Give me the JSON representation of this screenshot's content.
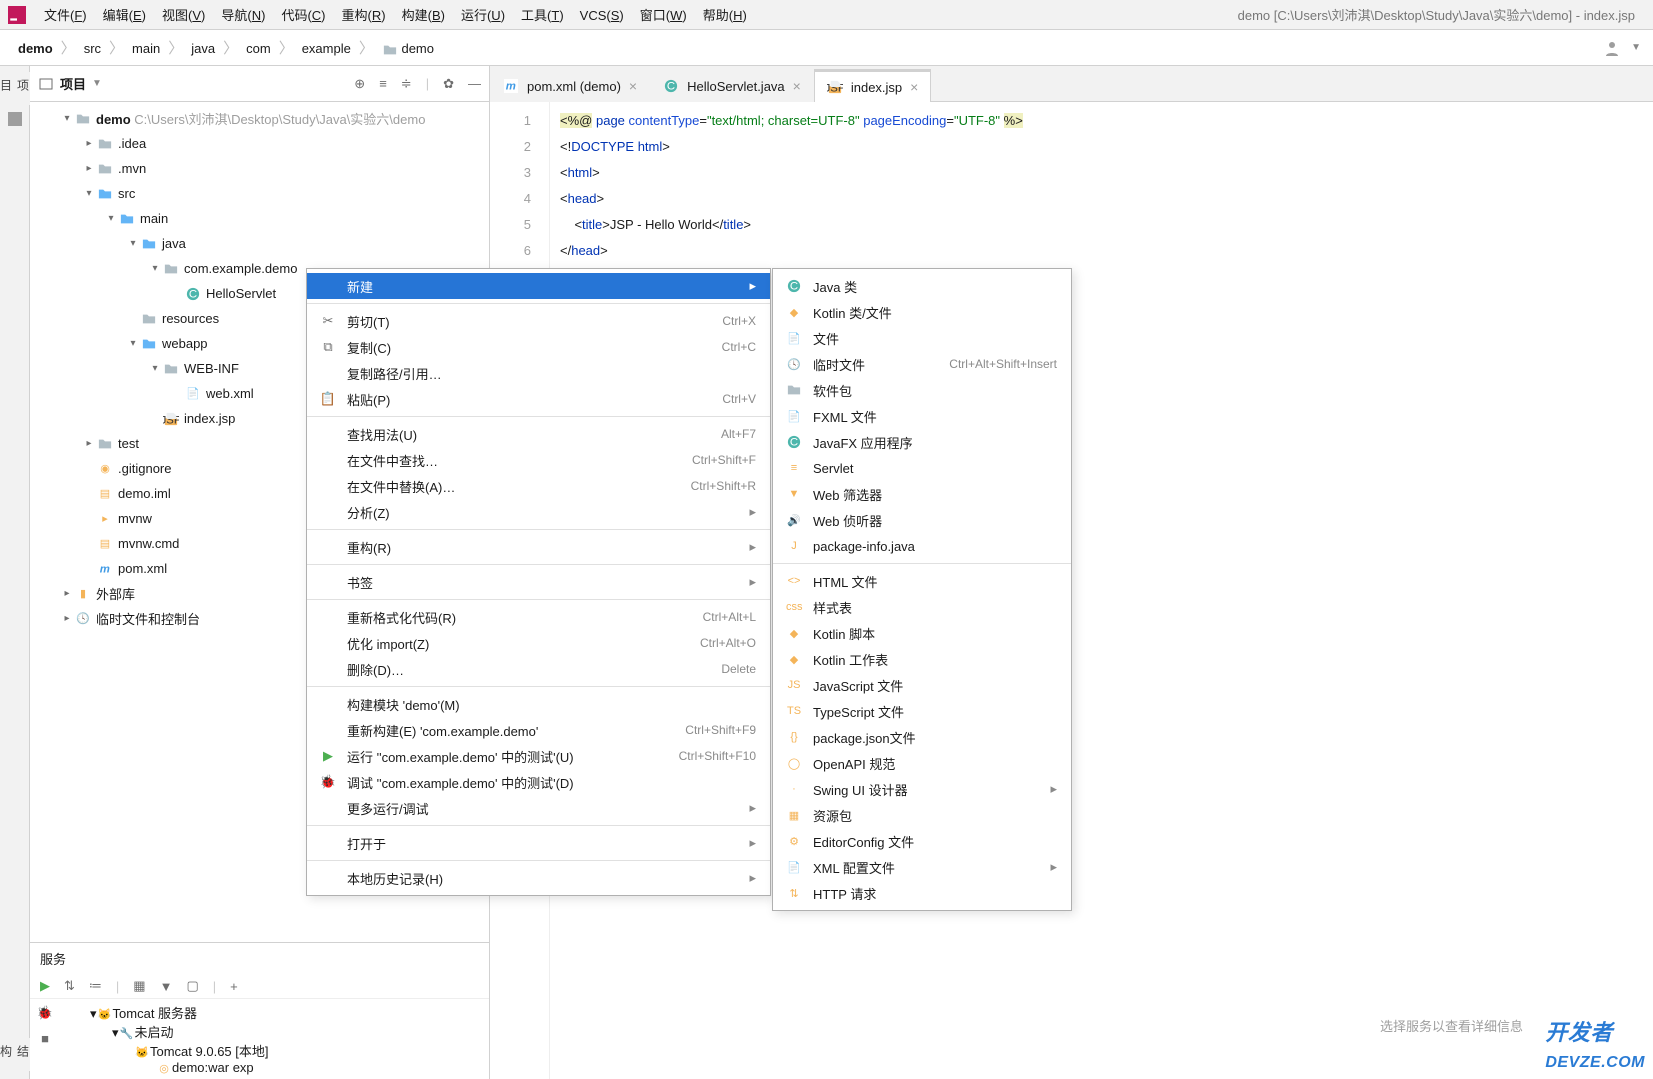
{
  "window": {
    "title": "demo [C:\\Users\\刘沛淇\\Desktop\\Study\\Java\\实验六\\demo] - index.jsp"
  },
  "menubar": [
    {
      "l": "文件",
      "u": "F"
    },
    {
      "l": "编辑",
      "u": "E"
    },
    {
      "l": "视图",
      "u": "V"
    },
    {
      "l": "导航",
      "u": "N"
    },
    {
      "l": "代码",
      "u": "C"
    },
    {
      "l": "重构",
      "u": "R"
    },
    {
      "l": "构建",
      "u": "B"
    },
    {
      "l": "运行",
      "u": "U"
    },
    {
      "l": "工具",
      "u": "T"
    },
    {
      "l": "VCS",
      "u": "S"
    },
    {
      "l": "窗口",
      "u": "W"
    },
    {
      "l": "帮助",
      "u": "H"
    }
  ],
  "breadcrumb": [
    "demo",
    "src",
    "main",
    "java",
    "com",
    "example",
    "demo"
  ],
  "sidebar": {
    "title": "项目",
    "root": {
      "name": "demo",
      "path": "C:\\Users\\刘沛淇\\Desktop\\Study\\Java\\实验六\\demo"
    },
    "tree": [
      {
        "d": 1,
        "a": "▾",
        "t": "folder-root",
        "n": "demo",
        "extra": " C:\\Users\\刘沛淇\\Desktop\\Study\\Java\\实验六\\demo"
      },
      {
        "d": 2,
        "a": "▸",
        "t": "folder",
        "n": ".idea"
      },
      {
        "d": 2,
        "a": "▸",
        "t": "folder",
        "n": ".mvn"
      },
      {
        "d": 2,
        "a": "▾",
        "t": "folder-blue",
        "n": "src"
      },
      {
        "d": 3,
        "a": "▾",
        "t": "folder-blue",
        "n": "main"
      },
      {
        "d": 4,
        "a": "▾",
        "t": "folder-blue",
        "n": "java"
      },
      {
        "d": 5,
        "a": "▾",
        "t": "pkg",
        "n": "com.example.demo"
      },
      {
        "d": 6,
        "a": " ",
        "t": "class",
        "n": "HelloServlet"
      },
      {
        "d": 4,
        "a": " ",
        "t": "folder-res",
        "n": "resources"
      },
      {
        "d": 4,
        "a": "▾",
        "t": "folder-web",
        "n": "webapp"
      },
      {
        "d": 5,
        "a": "▾",
        "t": "folder",
        "n": "WEB-INF"
      },
      {
        "d": 6,
        "a": " ",
        "t": "xml",
        "n": "web.xml"
      },
      {
        "d": 5,
        "a": " ",
        "t": "jsp",
        "n": "index.jsp"
      },
      {
        "d": 2,
        "a": "▸",
        "t": "folder",
        "n": "test"
      },
      {
        "d": 2,
        "a": " ",
        "t": "git",
        "n": ".gitignore"
      },
      {
        "d": 2,
        "a": " ",
        "t": "iml",
        "n": "demo.iml"
      },
      {
        "d": 2,
        "a": " ",
        "t": "sh",
        "n": "mvnw"
      },
      {
        "d": 2,
        "a": " ",
        "t": "cmd",
        "n": "mvnw.cmd"
      },
      {
        "d": 2,
        "a": " ",
        "t": "pom",
        "n": "pom.xml"
      }
    ],
    "extras": [
      {
        "d": 1,
        "a": "▸",
        "t": "lib",
        "n": "外部库"
      },
      {
        "d": 1,
        "a": "▸",
        "t": "scratch",
        "n": "临时文件和控制台"
      }
    ]
  },
  "services": {
    "title": "服务",
    "rows": [
      {
        "d": 1,
        "a": "▾",
        "t": "tomcat",
        "n": "Tomcat 服务器"
      },
      {
        "d": 2,
        "a": "▾",
        "t": "wrench",
        "n": "未启动"
      },
      {
        "d": 3,
        "a": " ",
        "t": "tomcat",
        "n": "Tomcat 9.0.65",
        "extra": " [本地]"
      },
      {
        "d": 4,
        "a": " ",
        "t": "artifact",
        "n": "demo:war exp"
      }
    ],
    "hint": "选择服务以查看详细信息"
  },
  "tabs": [
    {
      "icon": "pom",
      "label": "pom.xml (demo)"
    },
    {
      "icon": "class",
      "label": "HelloServlet.java"
    },
    {
      "icon": "jsp",
      "label": "index.jsp",
      "active": true
    }
  ],
  "code": {
    "lines": [
      "1",
      "2",
      "3",
      "4",
      "5",
      "6"
    ]
  },
  "contextMenu": {
    "items": [
      {
        "type": "item",
        "icon": "",
        "label": "新建",
        "sub": "▸",
        "sel": true
      },
      {
        "type": "sep"
      },
      {
        "type": "item",
        "icon": "✂",
        "label": "剪切(T)",
        "sc": "Ctrl+X"
      },
      {
        "type": "item",
        "icon": "⧉",
        "label": "复制(C)",
        "sc": "Ctrl+C"
      },
      {
        "type": "item",
        "icon": "",
        "label": "复制路径/引用…"
      },
      {
        "type": "item",
        "icon": "📋",
        "label": "粘贴(P)",
        "sc": "Ctrl+V"
      },
      {
        "type": "sep"
      },
      {
        "type": "item",
        "icon": "",
        "label": "查找用法(U)",
        "sc": "Alt+F7"
      },
      {
        "type": "item",
        "icon": "",
        "label": "在文件中查找…",
        "sc": "Ctrl+Shift+F"
      },
      {
        "type": "item",
        "icon": "",
        "label": "在文件中替换(A)…",
        "sc": "Ctrl+Shift+R"
      },
      {
        "type": "item",
        "icon": "",
        "label": "分析(Z)",
        "sub": "▸"
      },
      {
        "type": "sep"
      },
      {
        "type": "item",
        "icon": "",
        "label": "重构(R)",
        "sub": "▸"
      },
      {
        "type": "sep"
      },
      {
        "type": "item",
        "icon": "",
        "label": "书签",
        "sub": "▸"
      },
      {
        "type": "sep"
      },
      {
        "type": "item",
        "icon": "",
        "label": "重新格式化代码(R)",
        "sc": "Ctrl+Alt+L"
      },
      {
        "type": "item",
        "icon": "",
        "label": "优化 import(Z)",
        "sc": "Ctrl+Alt+O"
      },
      {
        "type": "item",
        "icon": "",
        "label": "删除(D)…",
        "sc": "Delete"
      },
      {
        "type": "sep"
      },
      {
        "type": "item",
        "icon": "",
        "label": "构建模块 'demo'(M)"
      },
      {
        "type": "item",
        "icon": "",
        "label": "重新构建(E) 'com.example.demo'",
        "sc": "Ctrl+Shift+F9"
      },
      {
        "type": "item",
        "icon": "▶",
        "label": "运行 ''com.example.demo' 中的测试'(U)",
        "sc": "Ctrl+Shift+F10",
        "iconColor": "#4caf50"
      },
      {
        "type": "item",
        "icon": "🐞",
        "label": "调试 ''com.example.demo' 中的测试'(D)"
      },
      {
        "type": "item",
        "icon": "",
        "label": "更多运行/调试",
        "sub": "▸"
      },
      {
        "type": "sep"
      },
      {
        "type": "item",
        "icon": "",
        "label": "打开于",
        "sub": "▸"
      },
      {
        "type": "sep"
      },
      {
        "type": "item",
        "icon": "",
        "label": "本地历史记录(H)",
        "sub": "▸"
      }
    ]
  },
  "newMenu": {
    "items": [
      {
        "icon": "class",
        "label": "Java 类"
      },
      {
        "icon": "kotlin",
        "label": "Kotlin 类/文件"
      },
      {
        "icon": "file",
        "label": "文件"
      },
      {
        "icon": "scratch",
        "label": "临时文件",
        "sc": "Ctrl+Alt+Shift+Insert"
      },
      {
        "icon": "pkg",
        "label": "软件包"
      },
      {
        "icon": "fxml",
        "label": "FXML 文件"
      },
      {
        "icon": "class",
        "label": "JavaFX 应用程序"
      },
      {
        "icon": "servlet",
        "label": "Servlet"
      },
      {
        "icon": "filter",
        "label": "Web 筛选器"
      },
      {
        "icon": "listener",
        "label": "Web 侦听器"
      },
      {
        "icon": "java",
        "label": "package-info.java"
      },
      {
        "type": "sep"
      },
      {
        "icon": "html",
        "label": "HTML 文件"
      },
      {
        "icon": "css",
        "label": "样式表"
      },
      {
        "icon": "kotlin",
        "label": "Kotlin 脚本"
      },
      {
        "icon": "kotlin",
        "label": "Kotlin 工作表"
      },
      {
        "icon": "js",
        "label": "JavaScript 文件"
      },
      {
        "icon": "ts",
        "label": "TypeScript 文件"
      },
      {
        "icon": "json",
        "label": "package.json文件"
      },
      {
        "icon": "openapi",
        "label": "OpenAPI 规范"
      },
      {
        "icon": "",
        "label": "Swing UI 设计器",
        "sub": "▸"
      },
      {
        "icon": "bundle",
        "label": "资源包"
      },
      {
        "icon": "editorconfig",
        "label": "EditorConfig 文件"
      },
      {
        "icon": "xml",
        "label": "XML 配置文件",
        "sub": "▸"
      },
      {
        "icon": "http",
        "label": "HTTP 请求"
      }
    ]
  },
  "watermark": "开发者\nDEVZE.COM"
}
